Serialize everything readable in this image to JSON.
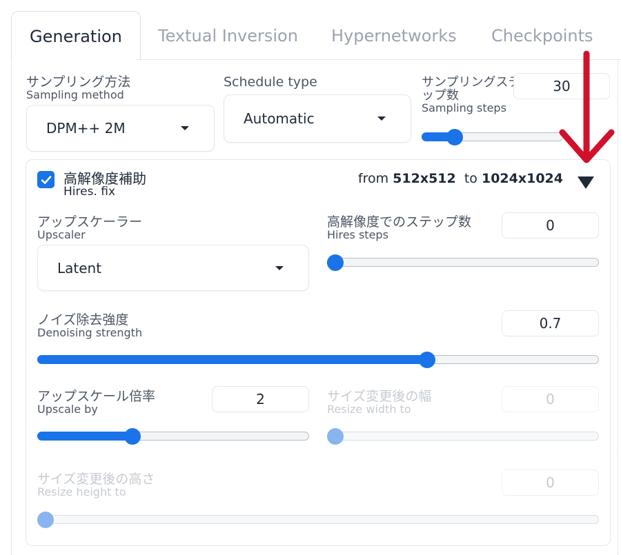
{
  "tabs": [
    {
      "label": "Generation",
      "active": true
    },
    {
      "label": "Textual Inversion",
      "active": false
    },
    {
      "label": "Hypernetworks",
      "active": false
    },
    {
      "label": "Checkpoints",
      "active": false
    }
  ],
  "sampling_method": {
    "label_jp": "サンプリング方法",
    "label_en": "Sampling method",
    "value": "DPM++ 2M"
  },
  "schedule_type": {
    "label": "Schedule type",
    "value": "Automatic"
  },
  "sampling_steps": {
    "label_jp_1": "サンプリングステ",
    "label_jp_2": "ップ数",
    "label_en": "Sampling steps",
    "value": "30",
    "fraction": 0.2
  },
  "hires_fix": {
    "checked": true,
    "label_jp": "高解像度補助",
    "label_en": "Hires. fix",
    "from_prefix": "from",
    "from_value": "512x512",
    "to_prefix": "to",
    "to_value": "1024x1024",
    "upscaler": {
      "label_jp": "アップスケーラー",
      "label_en": "Upscaler",
      "value": "Latent"
    },
    "hires_steps": {
      "label_jp": "高解像度でのステップ数",
      "label_en": "Hires steps",
      "value": "0",
      "fraction": 0.0
    },
    "denoising": {
      "label_jp": "ノイズ除去強度",
      "label_en": "Denoising strength",
      "value": "0.7",
      "fraction": 0.7
    },
    "upscale_by": {
      "label_jp": "アップスケール倍率",
      "label_en": "Upscale by",
      "value": "2",
      "fraction": 0.34
    },
    "resize_width": {
      "label_jp": "サイズ変更後の幅",
      "label_en": "Resize width to",
      "value": "0",
      "fraction": 0.0
    },
    "resize_height": {
      "label_jp": "サイズ変更後の高さ",
      "label_en": "Resize height to",
      "value": "0",
      "fraction": 0.0
    }
  },
  "colors": {
    "accent": "#1a73e8",
    "annotation_arrow": "#d0112b"
  },
  "icons": {
    "expand": "triangle-down-icon",
    "dropdown": "caret-down-icon",
    "check": "checkmark-icon",
    "annotation": "red-arrow-annotation"
  }
}
